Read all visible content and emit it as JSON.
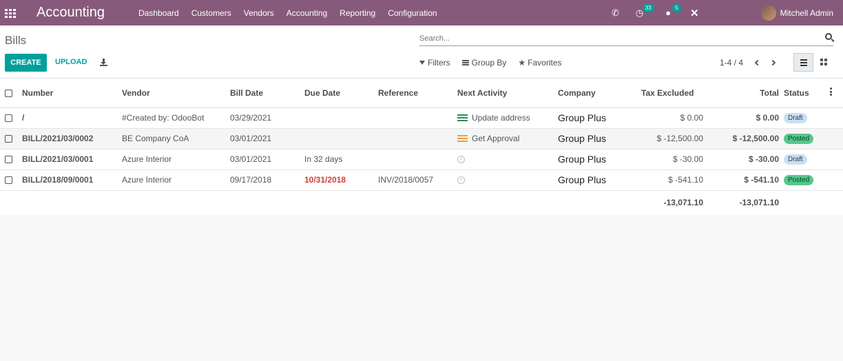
{
  "navbar": {
    "brand": "Accounting",
    "menu": [
      "Dashboard",
      "Customers",
      "Vendors",
      "Accounting",
      "Reporting",
      "Configuration"
    ],
    "activities_count": "33",
    "messages_count": "5",
    "user_name": "Mitchell Admin"
  },
  "control": {
    "breadcrumb": "Bills",
    "search_placeholder": "Search...",
    "create_label": "CREATE",
    "upload_label": "UPLOAD",
    "filters_label": "Filters",
    "groupby_label": "Group By",
    "favorites_label": "Favorites",
    "pager": "1-4 / 4"
  },
  "table": {
    "headers": {
      "number": "Number",
      "vendor": "Vendor",
      "bill_date": "Bill Date",
      "due_date": "Due Date",
      "reference": "Reference",
      "next_activity": "Next Activity",
      "company": "Company",
      "tax_excluded": "Tax Excluded",
      "total": "Total",
      "status": "Status"
    },
    "rows": [
      {
        "number": "/",
        "vendor": "#Created by: OdooBot",
        "bill_date": "03/29/2021",
        "due_date": "",
        "reference": "",
        "activity": "Update address",
        "company": "Group Plus",
        "tax_excluded": "$ 0.00",
        "total": "$ 0.00",
        "status": "Draft"
      },
      {
        "number": "BILL/2021/03/0002",
        "vendor": "BE Company CoA",
        "bill_date": "03/01/2021",
        "due_date": "",
        "reference": "",
        "activity": "Get Approval",
        "company": "Group Plus",
        "tax_excluded": "$ -12,500.00",
        "total": "$ -12,500.00",
        "status": "Posted"
      },
      {
        "number": "BILL/2021/03/0001",
        "vendor": "Azure Interior",
        "bill_date": "03/01/2021",
        "due_date": "In 32 days",
        "reference": "",
        "activity": "",
        "company": "Group Plus",
        "tax_excluded": "$ -30.00",
        "total": "$ -30.00",
        "status": "Draft"
      },
      {
        "number": "BILL/2018/09/0001",
        "vendor": "Azure Interior",
        "bill_date": "09/17/2018",
        "due_date": "10/31/2018",
        "reference": "INV/2018/0057",
        "activity": "",
        "company": "Group Plus",
        "tax_excluded": "$ -541.10",
        "total": "$ -541.10",
        "status": "Posted"
      }
    ],
    "totals": {
      "tax_excluded": "-13,071.10",
      "total": "-13,071.10"
    }
  },
  "colors": {
    "navbar": "#875a7b",
    "primary": "#00a09d",
    "overdue": "#d23f3a"
  }
}
